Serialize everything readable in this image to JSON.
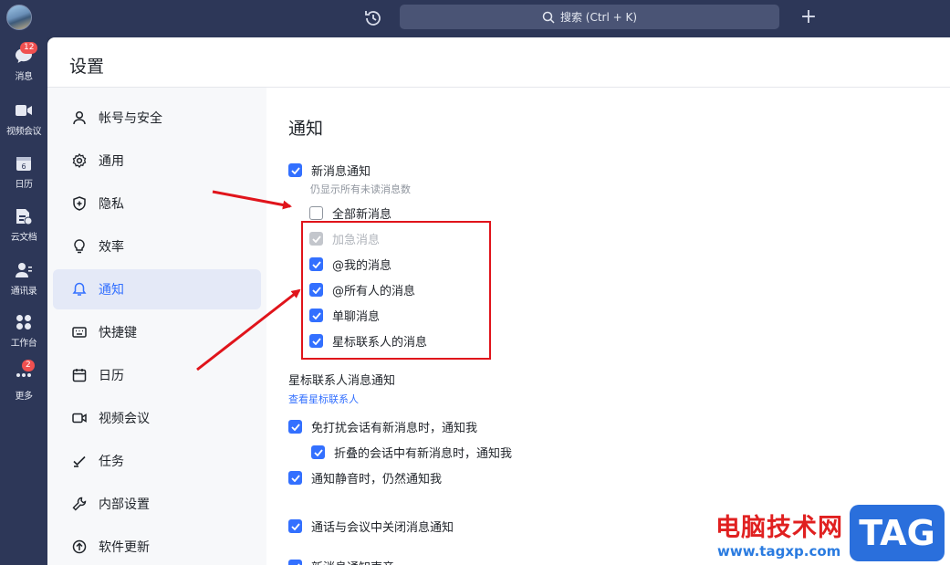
{
  "rail": {
    "items": [
      {
        "label": "消息",
        "badge": "12",
        "icon": "chat-bubble-icon"
      },
      {
        "label": "视频会议",
        "icon": "video-camera-icon"
      },
      {
        "label": "日历",
        "icon": "calendar-icon"
      },
      {
        "label": "云文档",
        "icon": "cloud-doc-icon"
      },
      {
        "label": "通讯录",
        "icon": "contacts-icon"
      },
      {
        "label": "工作台",
        "icon": "workbench-icon"
      },
      {
        "label": "更多",
        "badge": "2",
        "icon": "more-dots-icon"
      }
    ]
  },
  "topbar": {
    "search_placeholder": "搜索 (Ctrl + K)",
    "plus": "+"
  },
  "window": {
    "title": "设置"
  },
  "sidebar": {
    "items": [
      {
        "label": "帐号与安全",
        "icon": "user-icon"
      },
      {
        "label": "通用",
        "icon": "gear-icon"
      },
      {
        "label": "隐私",
        "icon": "shield-icon"
      },
      {
        "label": "效率",
        "icon": "lightbulb-icon"
      },
      {
        "label": "通知",
        "icon": "bell-icon",
        "active": true
      },
      {
        "label": "快捷键",
        "icon": "keyboard-icon"
      },
      {
        "label": "日历",
        "icon": "calendar-icon"
      },
      {
        "label": "视频会议",
        "icon": "video-camera-icon"
      },
      {
        "label": "任务",
        "icon": "check-task-icon"
      },
      {
        "label": "内部设置",
        "icon": "wrench-icon"
      },
      {
        "label": "软件更新",
        "icon": "upgrade-arrow-icon"
      }
    ]
  },
  "notify": {
    "title": "通知",
    "new_msg": {
      "label": "新消息通知",
      "checked": true
    },
    "hint": "仍显示所有未读消息数",
    "all_new": {
      "label": "全部新消息",
      "checked": false
    },
    "urgent": {
      "label": "加急消息",
      "checked": true,
      "disabled": true
    },
    "mention_me": {
      "label": "@我的消息",
      "checked": true
    },
    "mention_all": {
      "label": "@所有人的消息",
      "checked": true
    },
    "single_chat": {
      "label": "单聊消息",
      "checked": true
    },
    "starred": {
      "label": "星标联系人的消息",
      "checked": true
    },
    "starred_section": "星标联系人消息通知",
    "view_starred": "查看星标联系人",
    "dnd": {
      "label": "免打扰会话有新消息时，通知我",
      "checked": true
    },
    "folded": {
      "label": "折叠的会话中有新消息时，通知我",
      "checked": true
    },
    "muted": {
      "label": "通知静音时，仍然通知我",
      "checked": true
    },
    "in_call": {
      "label": "通话与会议中关闭消息通知",
      "checked": true
    },
    "sound": {
      "label": "新消息通知声音",
      "checked": true
    }
  },
  "watermark": {
    "cn": "电脑技术网",
    "url": "www.tagxp.com",
    "tag": "TAG"
  },
  "colors": {
    "accent": "#3370ff",
    "rail_bg": "#2d3758",
    "highlight": "#e0141b"
  }
}
